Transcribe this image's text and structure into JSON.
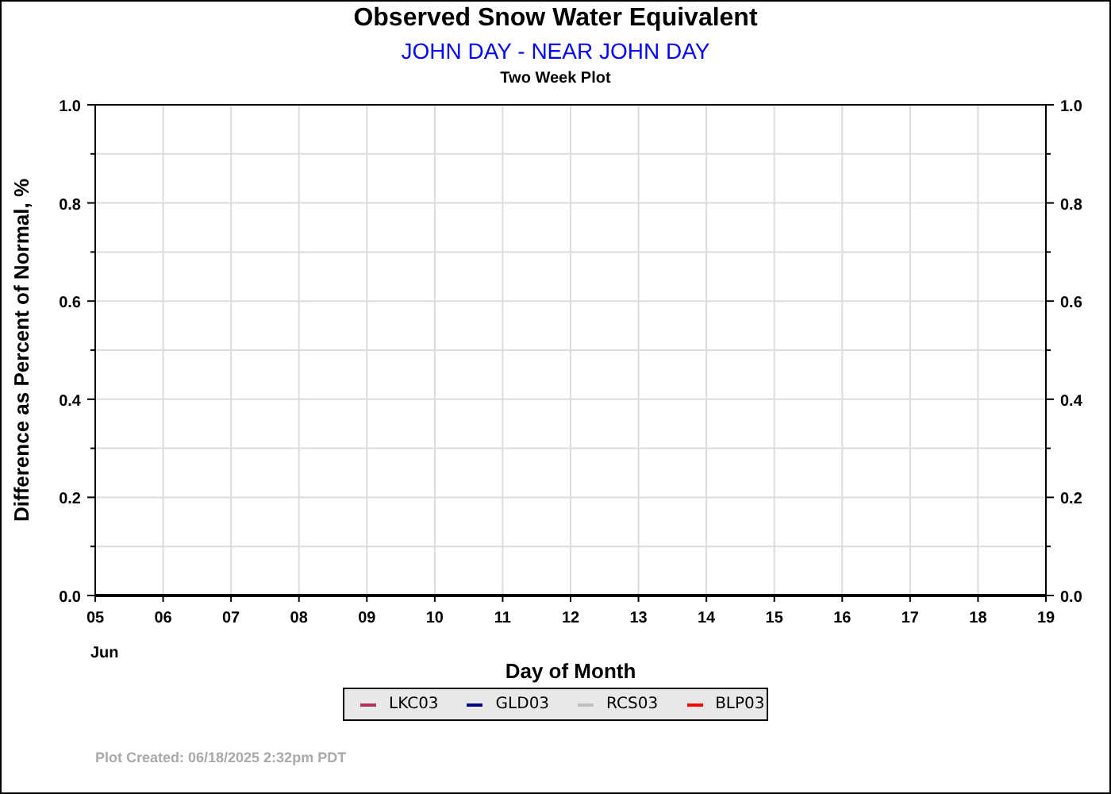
{
  "subtitle": "JOHN DAY - NEAR JOHN DAY",
  "caption": "Two Week Plot",
  "chart_data": {
    "type": "line",
    "title": "Observed Snow Water Equivalent",
    "xlabel": "Day of Month",
    "ylabel": "Difference as Percent of Normal, %",
    "categories": [
      "05",
      "06",
      "07",
      "08",
      "09",
      "10",
      "11",
      "12",
      "13",
      "14",
      "15",
      "16",
      "17",
      "18",
      "19"
    ],
    "ylim": [
      0,
      1
    ],
    "grid": true,
    "yticks": [
      {
        "value": 0,
        "label": "0.0"
      },
      {
        "value": 0.2,
        "label": "0.2"
      },
      {
        "value": 0.4,
        "label": "0.4"
      },
      {
        "value": 0.6,
        "label": "0.6"
      },
      {
        "value": 0.8,
        "label": "0.8"
      },
      {
        "value": 1,
        "label": "1.0"
      }
    ],
    "series": [
      {
        "name": "LKC03",
        "color": "#b03060",
        "values": [
          null,
          null,
          null,
          null,
          null,
          null,
          null,
          null,
          null,
          null,
          null,
          null,
          null,
          null,
          null
        ]
      },
      {
        "name": "GLD03",
        "color": "#000080",
        "values": [
          null,
          null,
          null,
          null,
          null,
          null,
          null,
          null,
          null,
          null,
          null,
          null,
          null,
          null,
          null
        ]
      },
      {
        "name": "RCS03",
        "color": "#c0c0c0",
        "values": [
          null,
          null,
          null,
          null,
          null,
          null,
          null,
          null,
          null,
          null,
          null,
          null,
          null,
          null,
          null
        ]
      },
      {
        "name": "BLP03",
        "color": "#ff0000",
        "values": [
          null,
          null,
          null,
          null,
          null,
          null,
          null,
          null,
          null,
          null,
          null,
          null,
          null,
          null,
          null
        ]
      }
    ]
  },
  "month_label": "Jun",
  "footer": "Plot Created: 06/18/2025 2:32pm PDT"
}
